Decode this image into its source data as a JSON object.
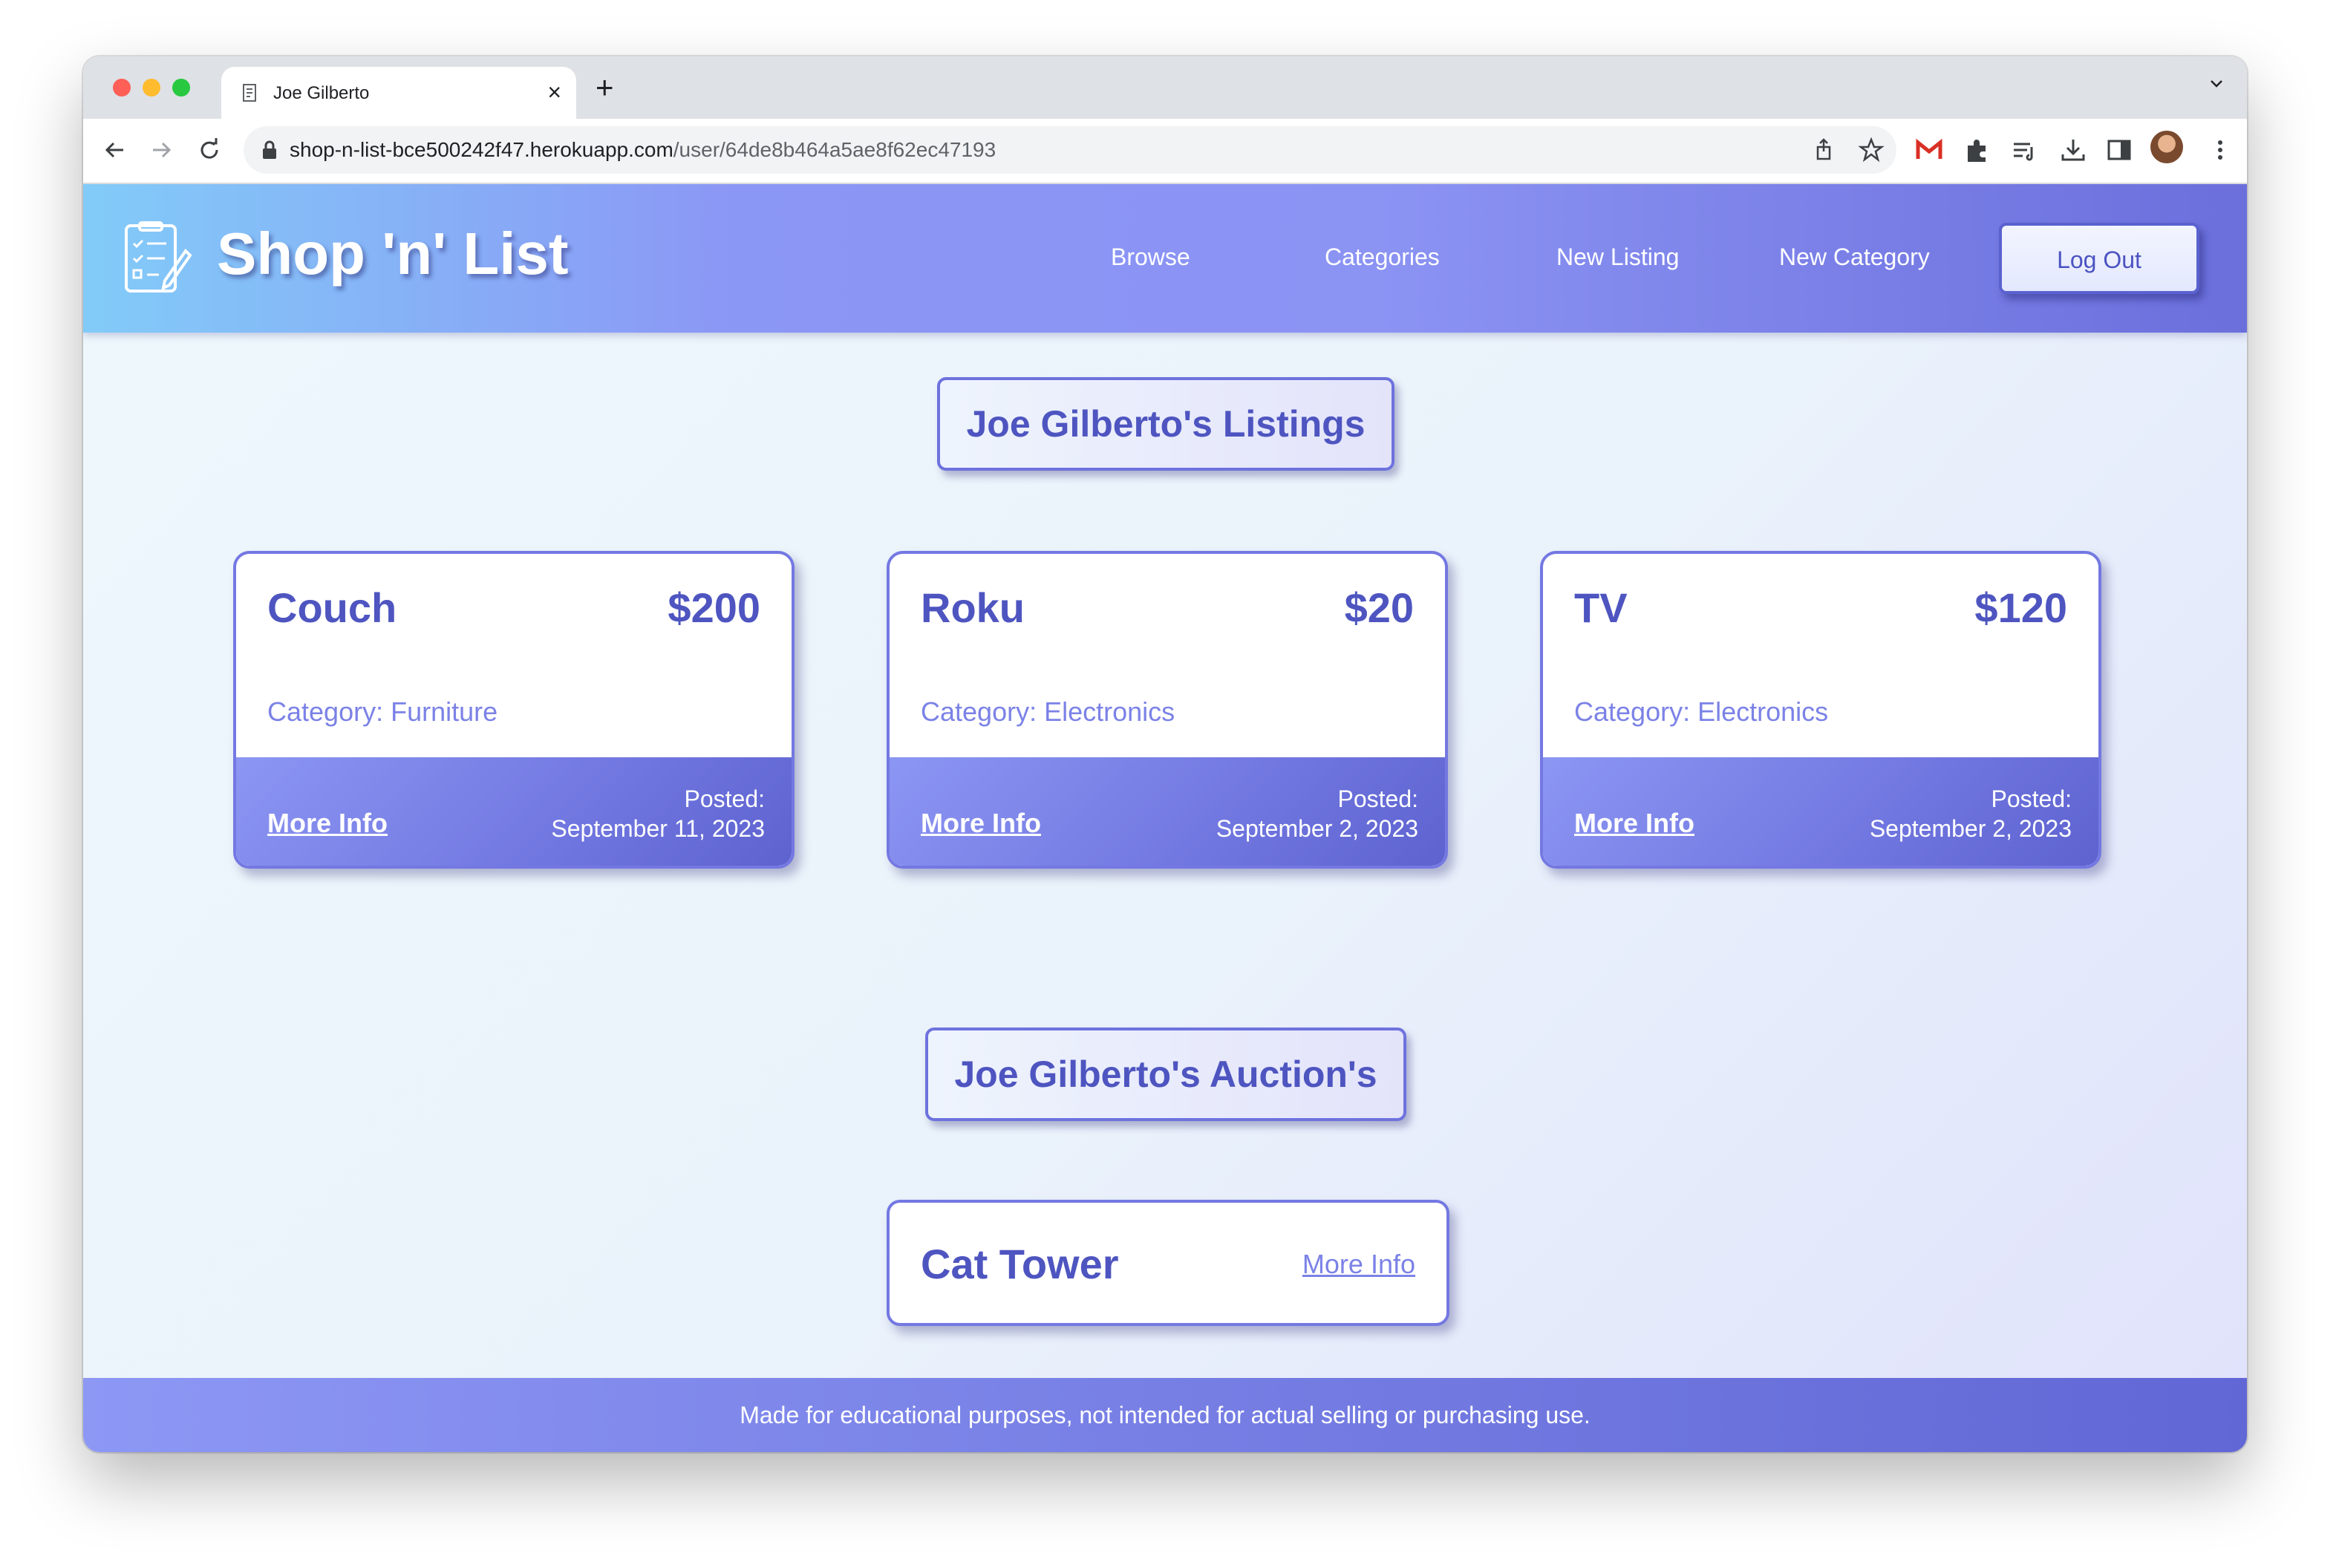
{
  "browser": {
    "tab_title": "Joe Gilberto",
    "url_host": "shop-n-list-bce500242f47.herokuapp.com",
    "url_path": "/user/64de8b464a5ae8f62ec47193"
  },
  "header": {
    "brand": "Shop 'n' List",
    "nav": [
      "Browse",
      "Categories",
      "New Listing",
      "New Category"
    ],
    "logout_label": "Log Out"
  },
  "listings_title": "Joe Gilberto's Listings",
  "listings": [
    {
      "name": "Couch",
      "price": "$200",
      "category": "Category: Furniture",
      "more": "More Info",
      "posted_label": "Posted:",
      "posted_date": "September 11, 2023"
    },
    {
      "name": "Roku",
      "price": "$20",
      "category": "Category: Electronics",
      "more": "More Info",
      "posted_label": "Posted:",
      "posted_date": "September 2, 2023"
    },
    {
      "name": "TV",
      "price": "$120",
      "category": "Category: Electronics",
      "more": "More Info",
      "posted_label": "Posted:",
      "posted_date": "September 2, 2023"
    }
  ],
  "auctions_title": "Joe Gilberto's Auction's",
  "auctions": [
    {
      "name": "Cat Tower",
      "more": "More Info"
    }
  ],
  "footer_text": "Made for educational purposes, not intended for actual selling or purchasing use.",
  "colors": {
    "accent": "#4e55c0",
    "header_start": "#82cbf8",
    "header_end": "#6b6fdc",
    "light_text": "#7b82e6"
  }
}
